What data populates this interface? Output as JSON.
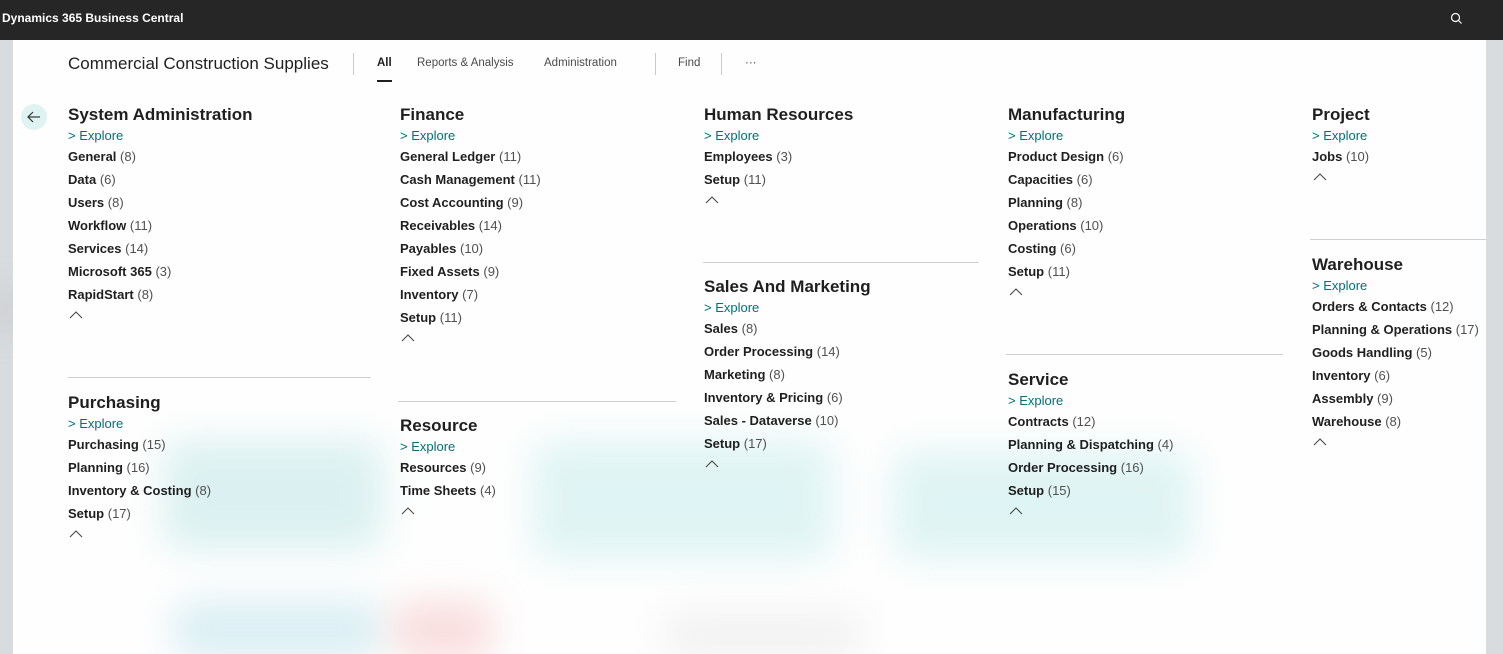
{
  "app": {
    "title": "Dynamics 365 Business Central"
  },
  "header": {
    "company": "Commercial Construction Supplies",
    "tabs": [
      {
        "label": "All",
        "active": true
      },
      {
        "label": "Reports & Analysis",
        "active": false
      },
      {
        "label": "Administration",
        "active": false
      },
      {
        "label": "Find",
        "active": false
      },
      {
        "label": "···",
        "active": false
      }
    ]
  },
  "explore_label": "> Explore",
  "groups": [
    {
      "title": "System Administration",
      "items": [
        {
          "name": "General",
          "count": "(8)"
        },
        {
          "name": "Data",
          "count": "(6)"
        },
        {
          "name": "Users",
          "count": "(8)"
        },
        {
          "name": "Workflow",
          "count": "(11)"
        },
        {
          "name": "Services",
          "count": "(14)"
        },
        {
          "name": "Microsoft 365",
          "count": "(3)"
        },
        {
          "name": "RapidStart",
          "count": "(8)"
        }
      ]
    },
    {
      "title": "Purchasing",
      "items": [
        {
          "name": "Purchasing",
          "count": "(15)"
        },
        {
          "name": "Planning",
          "count": "(16)"
        },
        {
          "name": "Inventory & Costing",
          "count": "(8)"
        },
        {
          "name": "Setup",
          "count": "(17)"
        }
      ]
    },
    {
      "title": "Finance",
      "items": [
        {
          "name": "General Ledger",
          "count": "(11)"
        },
        {
          "name": "Cash Management",
          "count": "(11)"
        },
        {
          "name": "Cost Accounting",
          "count": "(9)"
        },
        {
          "name": "Receivables",
          "count": "(14)"
        },
        {
          "name": "Payables",
          "count": "(10)"
        },
        {
          "name": "Fixed Assets",
          "count": "(9)"
        },
        {
          "name": "Inventory",
          "count": "(7)"
        },
        {
          "name": "Setup",
          "count": "(11)"
        }
      ]
    },
    {
      "title": "Resource",
      "items": [
        {
          "name": "Resources",
          "count": "(9)"
        },
        {
          "name": "Time Sheets",
          "count": "(4)"
        }
      ]
    },
    {
      "title": "Human Resources",
      "items": [
        {
          "name": "Employees",
          "count": "(3)"
        },
        {
          "name": "Setup",
          "count": "(11)"
        }
      ]
    },
    {
      "title": "Sales And Marketing",
      "items": [
        {
          "name": "Sales",
          "count": "(8)"
        },
        {
          "name": "Order Processing",
          "count": "(14)"
        },
        {
          "name": "Marketing",
          "count": "(8)"
        },
        {
          "name": "Inventory & Pricing",
          "count": "(6)"
        },
        {
          "name": "Sales - Dataverse",
          "count": "(10)"
        },
        {
          "name": "Setup",
          "count": "(17)"
        }
      ]
    },
    {
      "title": "Manufacturing",
      "items": [
        {
          "name": "Product Design",
          "count": "(6)"
        },
        {
          "name": "Capacities",
          "count": "(6)"
        },
        {
          "name": "Planning",
          "count": "(8)"
        },
        {
          "name": "Operations",
          "count": "(10)"
        },
        {
          "name": "Costing",
          "count": "(6)"
        },
        {
          "name": "Setup",
          "count": "(11)"
        }
      ]
    },
    {
      "title": "Service",
      "items": [
        {
          "name": "Contracts",
          "count": "(12)"
        },
        {
          "name": "Planning & Dispatching",
          "count": "(4)"
        },
        {
          "name": "Order Processing",
          "count": "(16)"
        },
        {
          "name": "Setup",
          "count": "(15)"
        }
      ]
    },
    {
      "title": "Project",
      "items": [
        {
          "name": "Jobs",
          "count": "(10)"
        }
      ]
    },
    {
      "title": "Warehouse",
      "items": [
        {
          "name": "Orders & Contacts",
          "count": "(12)"
        },
        {
          "name": "Planning & Operations",
          "count": "(17)"
        },
        {
          "name": "Goods Handling",
          "count": "(5)"
        },
        {
          "name": "Inventory",
          "count": "(6)"
        },
        {
          "name": "Assembly",
          "count": "(9)"
        },
        {
          "name": "Warehouse",
          "count": "(8)"
        }
      ]
    }
  ],
  "colors": {
    "topbar": "#262626",
    "accent": "#00707a",
    "back_button_bg": "#dff3f3"
  },
  "icons": {
    "search": "search-icon",
    "back": "back-arrow-icon",
    "collapse": "chevron-up-icon"
  }
}
